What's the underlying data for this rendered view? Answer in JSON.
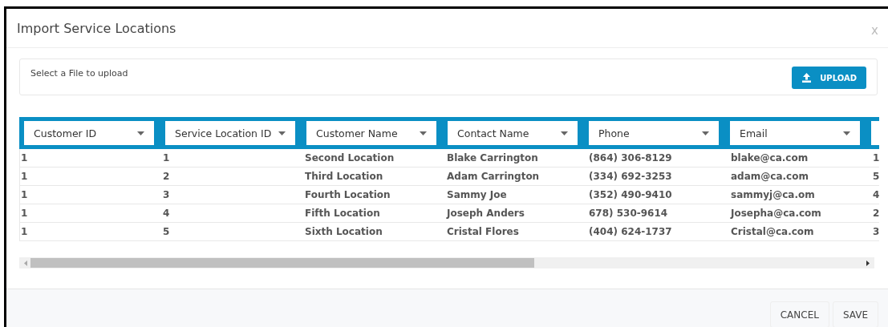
{
  "window": {
    "title": "Import Service Locations",
    "close": "x"
  },
  "upload": {
    "label": "Select a File to upload",
    "button": "UPLOAD"
  },
  "table": {
    "columns": [
      "Customer ID",
      "Service Location ID",
      "Customer Name",
      "Contact Name",
      "Phone",
      "Email",
      ""
    ],
    "rows": [
      [
        "1",
        "1",
        "Second Location",
        "Blake Carrington",
        "(864) 306-8129",
        "blake@ca.com",
        "1"
      ],
      [
        "1",
        "2",
        "Third Location",
        "Adam Carrington",
        "(334) 692-3253",
        "adam@ca.com",
        "5"
      ],
      [
        "1",
        "3",
        "Fourth Location",
        "Sammy Joe",
        "(352) 490-9410",
        "sammyj@ca.om",
        "4"
      ],
      [
        "1",
        "4",
        "Fifth Location",
        "Joseph Anders",
        "678) 530-9614",
        "Josepha@ca.com",
        "2"
      ],
      [
        "1",
        "5",
        "Sixth Location",
        "Cristal Flores",
        "(404) 624-1737",
        "Cristal@ca.com",
        "3"
      ]
    ]
  },
  "buttons": [
    "CANCEL",
    "SAVE"
  ]
}
